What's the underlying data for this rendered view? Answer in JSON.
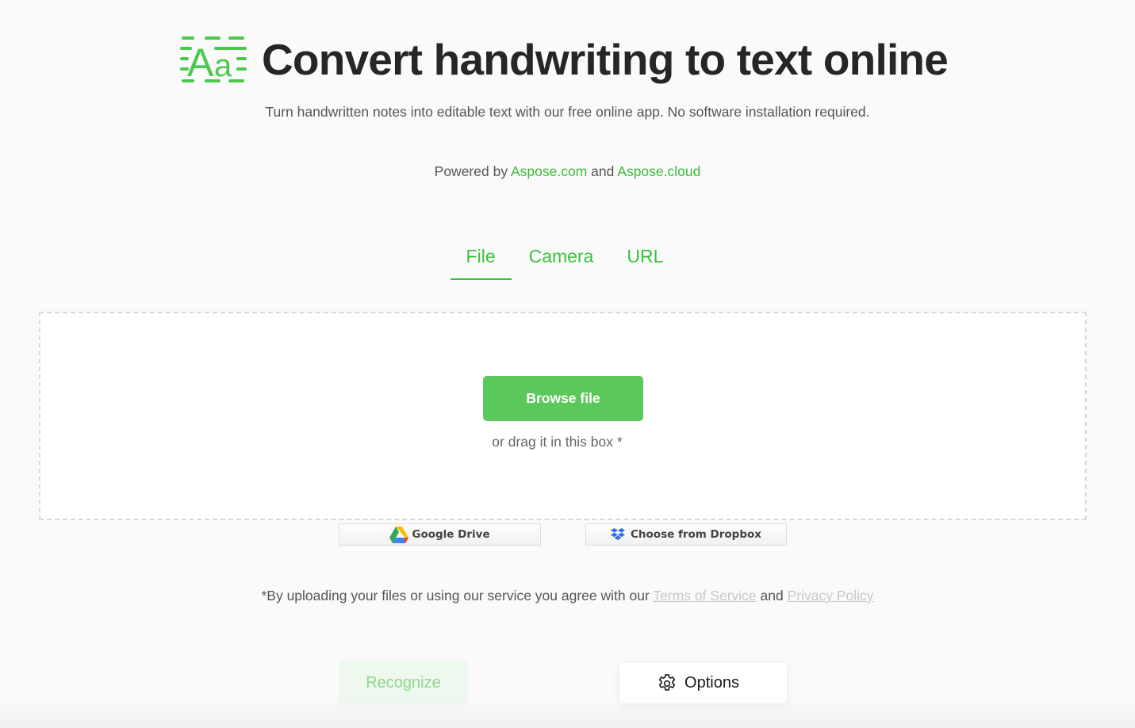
{
  "header": {
    "logo_icon": "text-aa-icon",
    "title": "Convert handwriting to text online",
    "subtitle": "Turn handwritten notes into editable text with our free online app. No software installation required."
  },
  "powered": {
    "prefix": "Powered by",
    "link1": "Aspose.com",
    "joiner": "and",
    "link2": "Aspose.cloud"
  },
  "tabs": [
    {
      "label": "File",
      "active": true
    },
    {
      "label": "Camera",
      "active": false
    },
    {
      "label": "URL",
      "active": false
    }
  ],
  "dropzone": {
    "browse_label": "Browse file",
    "drag_text": "or drag it in this box *"
  },
  "cloud": {
    "gdrive_label": "Google Drive",
    "gdrive_icon": "google-drive-icon",
    "dropbox_label": "Choose from Dropbox",
    "dropbox_icon": "dropbox-icon"
  },
  "terms": {
    "prefix": "*By uploading your files or using our service you agree with our",
    "tos": "Terms of Service",
    "joiner": "and",
    "privacy": "Privacy Policy"
  },
  "actions": {
    "recognize_label": "Recognize",
    "options_label": "Options",
    "options_icon": "gear-icon"
  },
  "colors": {
    "accent": "#3ebf3e",
    "button_green": "#5ac85a",
    "disabled_bg": "#eef8ee",
    "disabled_text": "#8cd88c",
    "title": "#262626",
    "muted_link": "#c8c8c8"
  }
}
